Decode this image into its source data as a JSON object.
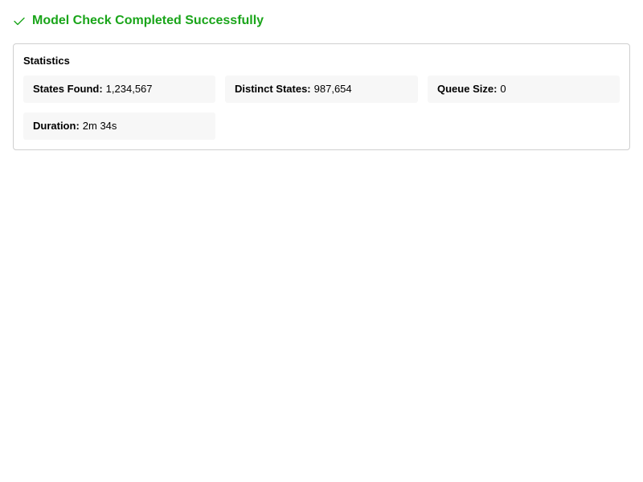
{
  "header": {
    "icon": "check-icon",
    "title": "Model Check Completed Successfully",
    "color": "#1aa51a"
  },
  "statistics": {
    "title": "Statistics",
    "items": [
      {
        "label": "States Found:",
        "value": "1,234,567"
      },
      {
        "label": "Distinct States:",
        "value": "987,654"
      },
      {
        "label": "Queue Size:",
        "value": "0"
      },
      {
        "label": "Duration:",
        "value": "2m 34s"
      }
    ]
  }
}
